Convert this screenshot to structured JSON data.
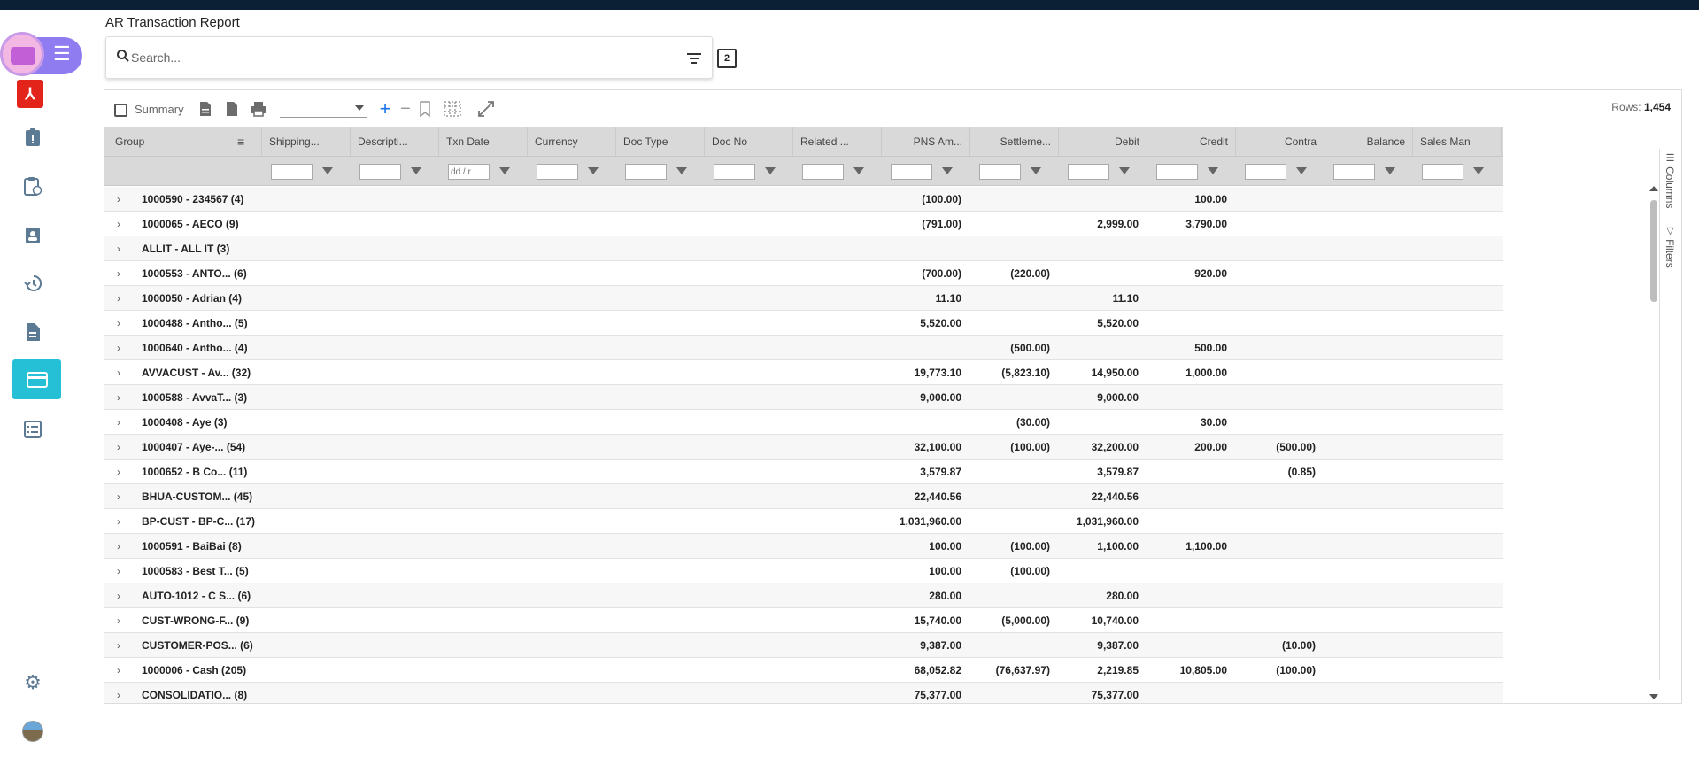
{
  "page": {
    "title": "AR Transaction Report"
  },
  "search": {
    "placeholder": "Search..."
  },
  "toolbar": {
    "summary_label": "Summary",
    "rows_label": "Rows:",
    "rows_value": "1,454",
    "icons": [
      "excel-export-icon",
      "pdf-export-icon",
      "print-icon",
      "expand-all-icon",
      "collapse-all-icon",
      "bookmark-icon",
      "grid-layout-icon",
      "fullscreen-icon"
    ]
  },
  "columns": [
    {
      "label": "Group"
    },
    {
      "label": "Shipping..."
    },
    {
      "label": "Descripti..."
    },
    {
      "label": "Txn Date"
    },
    {
      "label": "Currency"
    },
    {
      "label": "Doc Type"
    },
    {
      "label": "Doc No"
    },
    {
      "label": "Related ..."
    },
    {
      "label": "PNS Am..."
    },
    {
      "label": "Settleme..."
    },
    {
      "label": "Debit"
    },
    {
      "label": "Credit"
    },
    {
      "label": "Contra"
    },
    {
      "label": "Balance"
    },
    {
      "label": "Sales Man"
    }
  ],
  "date_filter_placeholder": "dd / r",
  "side_tabs": {
    "columns": "Columns",
    "filters": "Filters"
  },
  "rows": [
    {
      "group": "1000590 - 234567 (4)",
      "pns": "(100.00)",
      "settle": "",
      "debit": "",
      "credit": "100.00",
      "contra": ""
    },
    {
      "group": "1000065 - AECO (9)",
      "pns": "(791.00)",
      "settle": "",
      "debit": "2,999.00",
      "credit": "3,790.00",
      "contra": ""
    },
    {
      "group": "ALLIT - ALL IT (3)",
      "pns": "",
      "settle": "",
      "debit": "",
      "credit": "",
      "contra": ""
    },
    {
      "group": "1000553 - ANTO...  (6)",
      "pns": "(700.00)",
      "settle": "(220.00)",
      "debit": "",
      "credit": "920.00",
      "contra": ""
    },
    {
      "group": "1000050 - Adrian (4)",
      "pns": "11.10",
      "settle": "",
      "debit": "11.10",
      "credit": "",
      "contra": ""
    },
    {
      "group": "1000488 - Antho... (5)",
      "pns": "5,520.00",
      "settle": "",
      "debit": "5,520.00",
      "credit": "",
      "contra": ""
    },
    {
      "group": "1000640 - Antho... (4)",
      "pns": "",
      "settle": "(500.00)",
      "debit": "",
      "credit": "500.00",
      "contra": ""
    },
    {
      "group": "AVVACUST - Av... (32)",
      "pns": "19,773.10",
      "settle": "(5,823.10)",
      "debit": "14,950.00",
      "credit": "1,000.00",
      "contra": ""
    },
    {
      "group": "1000588 - AvvaT... (3)",
      "pns": "9,000.00",
      "settle": "",
      "debit": "9,000.00",
      "credit": "",
      "contra": ""
    },
    {
      "group": "1000408 - Aye (3)",
      "pns": "",
      "settle": "(30.00)",
      "debit": "",
      "credit": "30.00",
      "contra": ""
    },
    {
      "group": "1000407 - Aye-... (54)",
      "pns": "32,100.00",
      "settle": "(100.00)",
      "debit": "32,200.00",
      "credit": "200.00",
      "contra": "(500.00)"
    },
    {
      "group": "1000652 - B Co... (11)",
      "pns": "3,579.87",
      "settle": "",
      "debit": "3,579.87",
      "credit": "",
      "contra": "(0.85)"
    },
    {
      "group": "BHUA-CUSTOM... (45)",
      "pns": "22,440.56",
      "settle": "",
      "debit": "22,440.56",
      "credit": "",
      "contra": ""
    },
    {
      "group": "BP-CUST - BP-C... (17)",
      "pns": "1,031,960.00",
      "settle": "",
      "debit": "1,031,960.00",
      "credit": "",
      "contra": ""
    },
    {
      "group": "1000591 - BaiBai (8)",
      "pns": "100.00",
      "settle": "(100.00)",
      "debit": "1,100.00",
      "credit": "1,100.00",
      "contra": ""
    },
    {
      "group": "1000583 - Best T... (5)",
      "pns": "100.00",
      "settle": "(100.00)",
      "debit": "",
      "credit": "",
      "contra": ""
    },
    {
      "group": "AUTO-1012 - C S... (6)",
      "pns": "280.00",
      "settle": "",
      "debit": "280.00",
      "credit": "",
      "contra": ""
    },
    {
      "group": "CUST-WRONG-F... (9)",
      "pns": "15,740.00",
      "settle": "(5,000.00)",
      "debit": "10,740.00",
      "credit": "",
      "contra": ""
    },
    {
      "group": "CUSTOMER-POS... (6)",
      "pns": "9,387.00",
      "settle": "",
      "debit": "9,387.00",
      "credit": "",
      "contra": "(10.00)"
    },
    {
      "group": "1000006 - Cash (205)",
      "pns": "68,052.82",
      "settle": "(76,637.97)",
      "debit": "2,219.85",
      "credit": "10,805.00",
      "contra": "(100.00)"
    },
    {
      "group": "CONSOLIDATIO...  (8)",
      "pns": "75,377.00",
      "settle": "",
      "debit": "75,377.00",
      "credit": "",
      "contra": ""
    }
  ],
  "colors": {
    "topbar": "#0b1f35",
    "accent": "#26c0d6",
    "brand_pill": "#8e7cf0",
    "acrobat": "#e3241b"
  }
}
